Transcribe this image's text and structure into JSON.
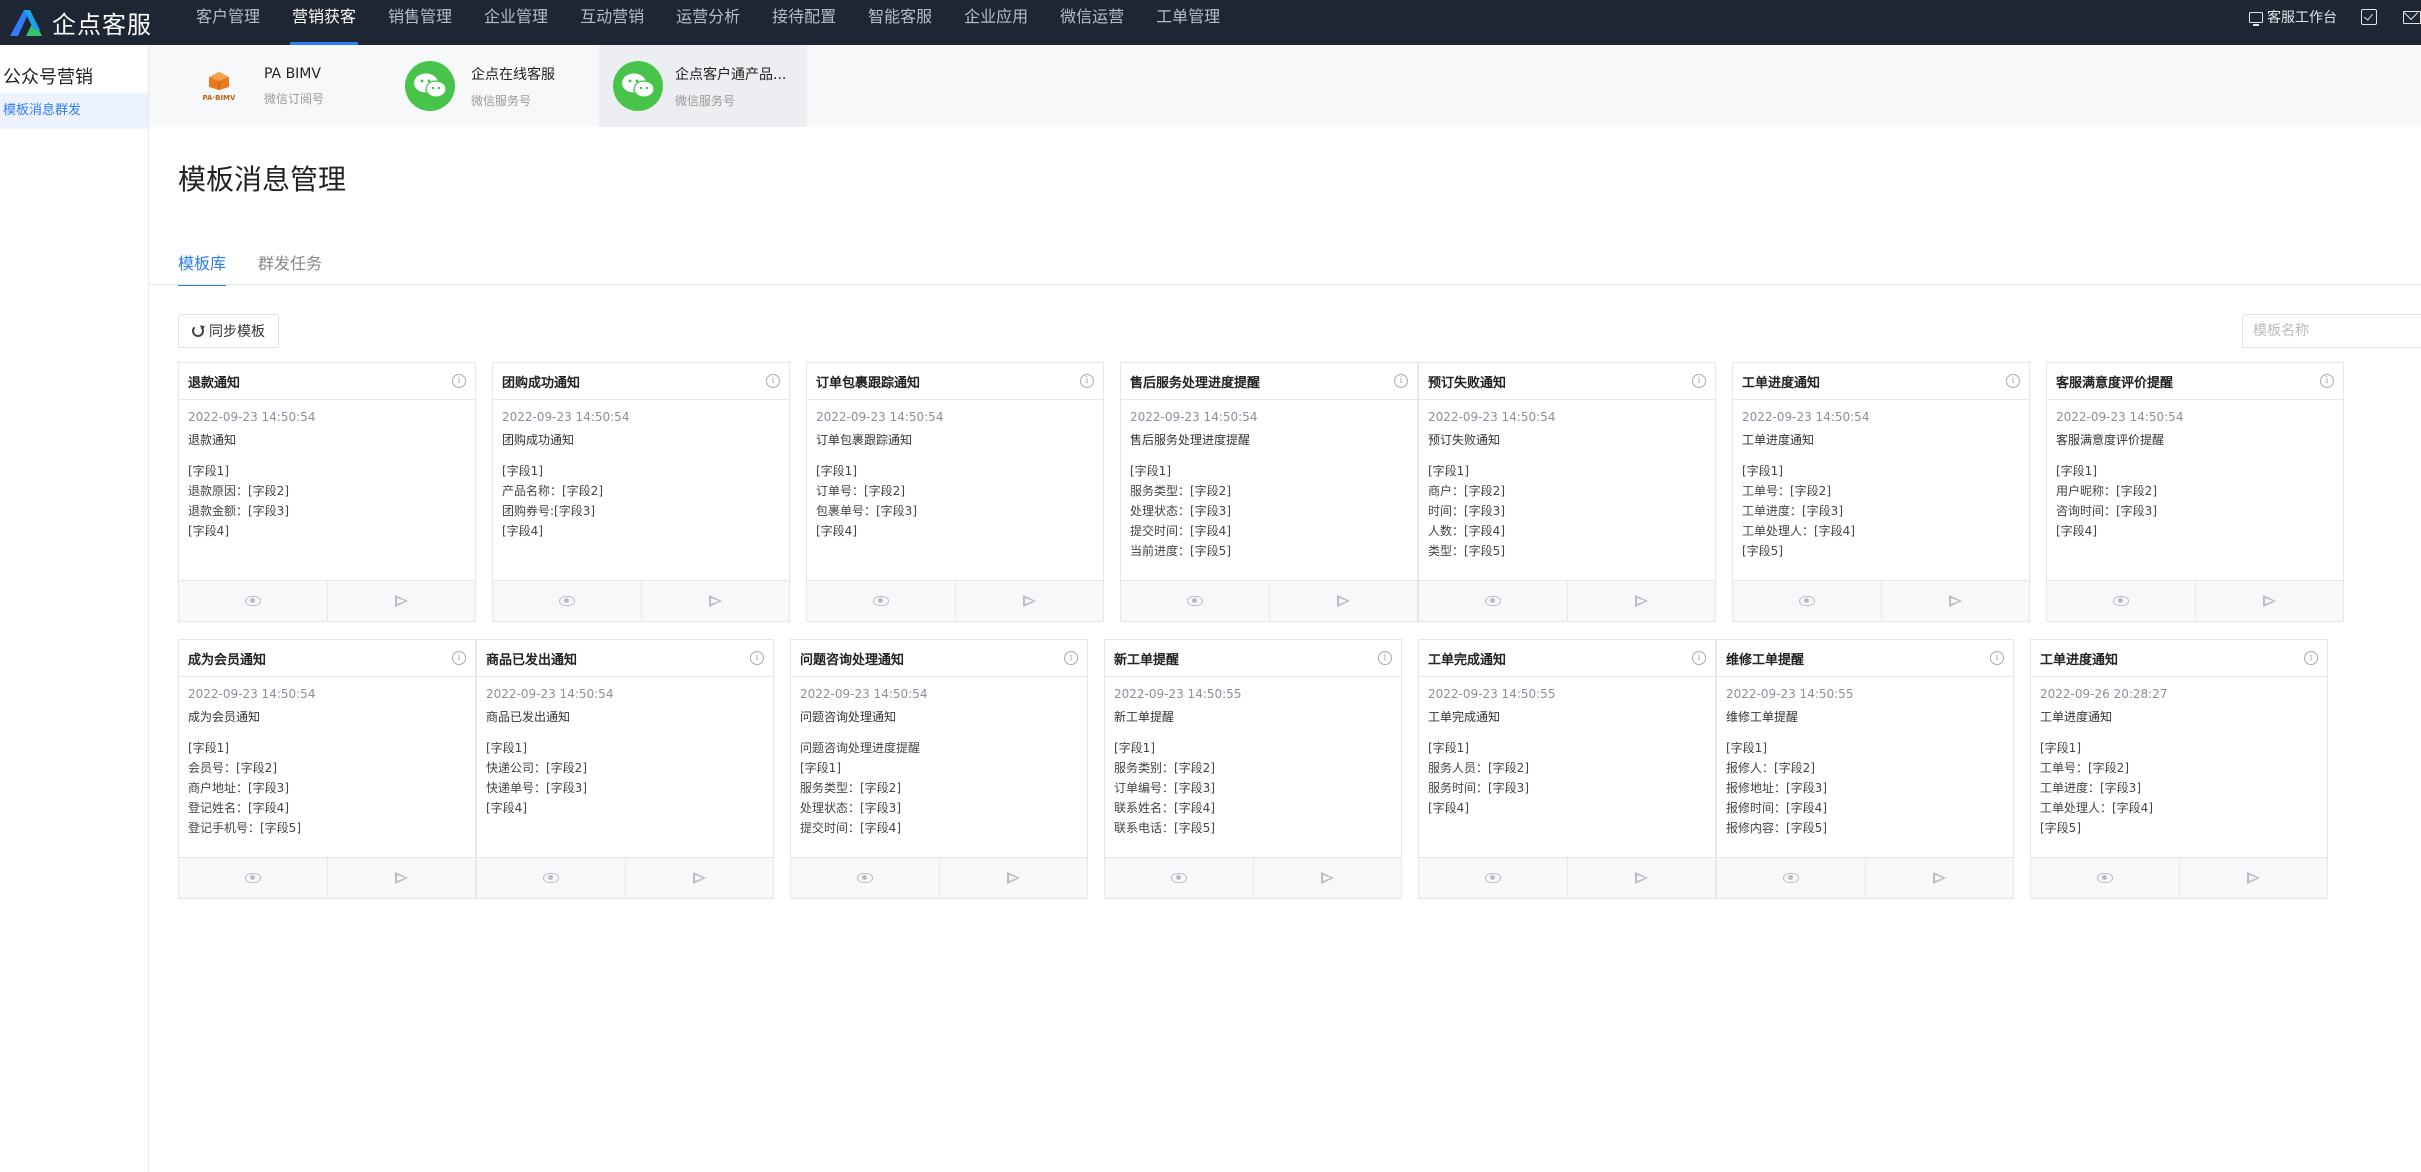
{
  "app": {
    "brand": "企点客服"
  },
  "topnav": {
    "items": [
      "客户管理",
      "营销获客",
      "销售管理",
      "企业管理",
      "互动营销",
      "运营分析",
      "接待配置",
      "智能客服",
      "企业应用",
      "微信运营",
      "工单管理"
    ],
    "active": "营销获客",
    "workbench_label": "客服工作台"
  },
  "sidebar": {
    "title": "公众号营销",
    "items": [
      "模板消息群发"
    ]
  },
  "accounts": [
    {
      "name": "PA BIMV",
      "type": "微信订阅号",
      "logo_text": "PA·BIMV"
    },
    {
      "name": "企点在线客服",
      "type": "微信服务号"
    },
    {
      "name": "企点客户通产品...",
      "type": "微信服务号"
    }
  ],
  "page": {
    "title": "模板消息管理",
    "tabs": [
      "模板库",
      "群发任务"
    ],
    "sync_label": "同步模板",
    "search_placeholder": "模板名称"
  },
  "templates": [
    {
      "title": "退款通知",
      "date": "2022-09-23 14:50:54",
      "subtitle": "退款通知",
      "lines": [
        "[字段1]",
        "退款原因：[字段2]",
        "退款金额：[字段3]",
        "[字段4]"
      ]
    },
    {
      "title": "团购成功通知",
      "date": "2022-09-23 14:50:54",
      "subtitle": "团购成功通知",
      "lines": [
        "[字段1]",
        "产品名称：[字段2]",
        "团购券号:[字段3]",
        "[字段4]"
      ]
    },
    {
      "title": "订单包裹跟踪通知",
      "date": "2022-09-23 14:50:54",
      "subtitle": "订单包裹跟踪通知",
      "lines": [
        "[字段1]",
        "订单号：[字段2]",
        "包裹单号：[字段3]",
        "[字段4]"
      ]
    },
    {
      "title": "售后服务处理进度提醒",
      "date": "2022-09-23 14:50:54",
      "subtitle": "售后服务处理进度提醒",
      "lines": [
        "[字段1]",
        "服务类型：[字段2]",
        "处理状态：[字段3]",
        "提交时间：[字段4]",
        "当前进度：[字段5]"
      ]
    },
    {
      "title": "预订失败通知",
      "date": "2022-09-23 14:50:54",
      "subtitle": "预订失败通知",
      "lines": [
        "[字段1]",
        "商户：[字段2]",
        "时间：[字段3]",
        "人数：[字段4]",
        "类型：[字段5]"
      ]
    },
    {
      "title": "工单进度通知",
      "date": "2022-09-23 14:50:54",
      "subtitle": "工单进度通知",
      "lines": [
        "[字段1]",
        "工单号：[字段2]",
        "工单进度：[字段3]",
        "工单处理人：[字段4]",
        "[字段5]"
      ]
    },
    {
      "title": "客服满意度评价提醒",
      "date": "2022-09-23 14:50:54",
      "subtitle": "客服满意度评价提醒",
      "lines": [
        "[字段1]",
        "用户昵称：[字段2]",
        "咨询时间：[字段3]",
        "[字段4]"
      ]
    },
    {
      "title": "成为会员通知",
      "date": "2022-09-23 14:50:54",
      "subtitle": "成为会员通知",
      "lines": [
        "[字段1]",
        "会员号：[字段2]",
        "商户地址：[字段3]",
        "登记姓名：[字段4]",
        "登记手机号：[字段5]"
      ]
    },
    {
      "title": "商品已发出通知",
      "date": "2022-09-23 14:50:54",
      "subtitle": "商品已发出通知",
      "lines": [
        "[字段1]",
        "快递公司：[字段2]",
        "快递单号：[字段3]",
        "[字段4]"
      ]
    },
    {
      "title": "问题咨询处理通知",
      "date": "2022-09-23 14:50:54",
      "subtitle": "问题咨询处理通知",
      "lines": [
        "问题咨询处理进度提醒",
        "[字段1]",
        "服务类型：[字段2]",
        "处理状态：[字段3]",
        "提交时间：[字段4]"
      ]
    },
    {
      "title": "新工单提醒",
      "date": "2022-09-23 14:50:55",
      "subtitle": "新工单提醒",
      "lines": [
        "[字段1]",
        "服务类别：[字段2]",
        "订单编号：[字段3]",
        "联系姓名：[字段4]",
        "联系电话：[字段5]"
      ]
    },
    {
      "title": "工单完成通知",
      "date": "2022-09-23 14:50:55",
      "subtitle": "工单完成通知",
      "lines": [
        "[字段1]",
        "服务人员：[字段2]",
        "服务时间：[字段3]",
        "[字段4]"
      ]
    },
    {
      "title": "维修工单提醒",
      "date": "2022-09-23 14:50:55",
      "subtitle": "维修工单提醒",
      "lines": [
        "[字段1]",
        "报修人：[字段2]",
        "报修地址：[字段3]",
        "报修时间：[字段4]",
        "报修内容：[字段5]"
      ]
    },
    {
      "title": "工单进度通知",
      "date": "2022-09-26 20:28:27",
      "subtitle": "工单进度通知",
      "lines": [
        "[字段1]",
        "工单号：[字段2]",
        "工单进度：[字段3]",
        "工单处理人：[字段4]",
        "[字段5]"
      ]
    }
  ],
  "colors": {
    "primary": "#2f7cf6",
    "nav_bg": "#1e2633",
    "wechat_green": "#47c449",
    "pa_orange": "#e87a1e"
  }
}
